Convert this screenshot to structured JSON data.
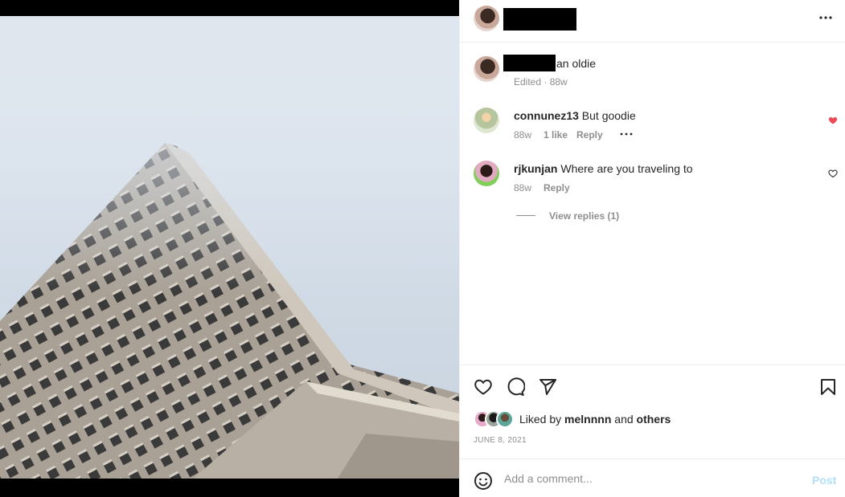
{
  "header": {
    "more_icon": "more-horizontal-icon"
  },
  "caption": {
    "text": "an oldie",
    "meta": "Edited · 88w"
  },
  "comments": [
    {
      "username": "connunez13",
      "text": "But goodie",
      "time": "88w",
      "likes": "1 like",
      "reply": "Reply",
      "liked": true,
      "heart_color": "#ed4956"
    },
    {
      "username": "rjkunjan",
      "text": "Where are you traveling to",
      "time": "88w",
      "reply": "Reply",
      "liked": false,
      "view_replies": "View replies (1)"
    }
  ],
  "actions": {
    "icons": [
      "heart-icon",
      "comment-icon",
      "share-icon",
      "bookmark-icon"
    ],
    "liked_by_prefix": "Liked by ",
    "liked_by_user": "melnnnn",
    "liked_by_mid": " and ",
    "liked_by_others": "others",
    "date": "JUNE 8, 2021"
  },
  "comment_box": {
    "placeholder": "Add a comment...",
    "post_label": "Post",
    "post_color": "#b2dffc",
    "emoji_icon": "emoji-icon"
  }
}
